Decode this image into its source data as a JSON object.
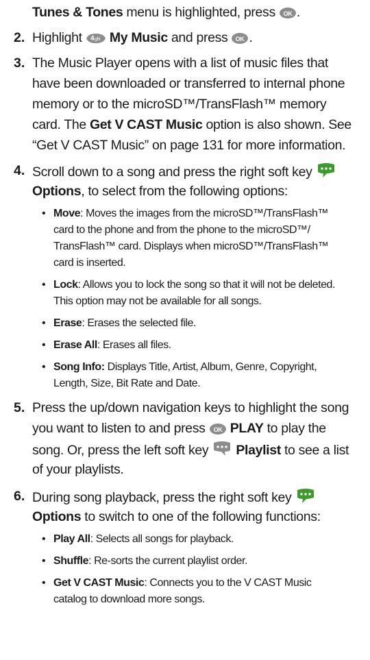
{
  "step1": {
    "bold": "Tunes & Tones",
    "tail": " menu is highlighted, press ",
    "end": "."
  },
  "step2": {
    "num": "2.",
    "pre": "Highlight ",
    "bold": "My Music",
    "mid": " and press ",
    "end": "."
  },
  "step3": {
    "num": "3.",
    "line1": "The Music Player opens with a list of music files that",
    "line2": "have been downloaded or transferred to internal phone",
    "line3": "memory or to the microSD™/TransFlash™ memory",
    "line4_pre": "card. The ",
    "line4_bold": "Get V CAST Music",
    "line4_post": " option is also shown. See",
    "line5": "“Get V CAST Music” on page 131 for more information."
  },
  "step4": {
    "num": "4.",
    "line1": "Scroll down to a song and press the right soft key ",
    "line2_bold": "Options",
    "line2_post": ", to select from the following options:",
    "options": [
      {
        "bold": "Move",
        "lines": [
          ":  Moves the images from the microSD™/TransFlash™",
          "card to the phone and from the phone to the microSD™/",
          "TransFlash™ card.  Displays when microSD™/TransFlash™",
          "card is inserted."
        ]
      },
      {
        "bold": "Lock",
        "lines": [
          ": Allows you to lock the song so that it will not be deleted.",
          "This option may not be available for all songs."
        ]
      },
      {
        "bold": "Erase",
        "lines": [
          ": Erases the selected file."
        ]
      },
      {
        "bold": "Erase All",
        "lines": [
          ": Erases all files."
        ]
      },
      {
        "bold": "Song Info:",
        "lines": [
          " Displays Title, Artist, Album, Genre, Copyright,",
          "Length, Size, Bit Rate and Date."
        ]
      }
    ]
  },
  "step5": {
    "num": "5.",
    "line1": "Press the up/down navigation keys to highlight the song",
    "line2_pre": "you want to listen to and press ",
    "line2_bold": "PLAY",
    "line2_post": " to play the",
    "line3_pre": "song. Or, press the left soft key ",
    "line3_bold": "Playlist",
    "line3_post": " to see a list",
    "line4": "of your playlists."
  },
  "step6": {
    "num": "6.",
    "line1": "During song playback, press the right soft key ",
    "line2_bold": "Options",
    "line2_post": " to switch to one of the following functions:",
    "options": [
      {
        "bold": "Play All",
        "lines": [
          ": Selects all songs for playback."
        ]
      },
      {
        "bold": "Shuffle",
        "lines": [
          ": Re-sorts the current playlist order."
        ]
      },
      {
        "bold": "Get V CAST Music",
        "lines": [
          ": Connects you to the V CAST Music",
          "catalog to download more songs."
        ]
      }
    ]
  },
  "bullet_char": "•",
  "icons": {
    "ok": "ok-button-icon",
    "key4": "number-4-key-icon",
    "right_soft": "right-soft-key-icon",
    "left_soft": "left-soft-key-icon"
  },
  "colors": {
    "text": "#1a1a1a",
    "icon_gray": "#8c8c8c",
    "icon_green": "#3f9a2e"
  }
}
